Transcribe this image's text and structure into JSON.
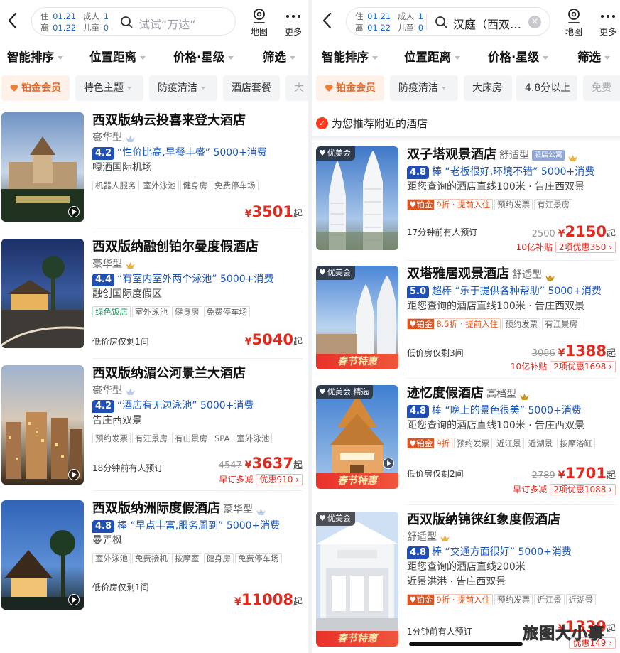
{
  "colors": {
    "accent_blue": "#1a55b8",
    "price_red": "#e02a1f",
    "platinum_orange": "#e46a2b"
  },
  "left": {
    "search": {
      "checkin_label": "住",
      "checkin_date": "01.21",
      "checkout_label": "离",
      "checkout_date": "01.22",
      "adult_label": "成人",
      "adult_count": "1",
      "child_label": "儿童",
      "child_count": "0",
      "placeholder": "试试“万达”"
    },
    "map_label": "地图",
    "more_label": "更多",
    "sort": [
      "智能排序",
      "位置距离",
      "价格·星级",
      "筛选"
    ],
    "chips": [
      "铂金会员",
      "特色主题",
      "防疫清洁",
      "酒店套餐",
      "大"
    ],
    "hotels": [
      {
        "name": "西双版纳云投喜来登大酒店",
        "level": "豪华型",
        "score": "4.2",
        "review": "“性价比高,早餐丰盛”",
        "consumers": "5000+消费",
        "location": "嘎洒国际机场",
        "tags": [
          "机器人服务",
          "室外泳池",
          "健身房",
          "免费停车场"
        ],
        "note": "",
        "price": "3501",
        "currency": "¥",
        "qi": "起",
        "old_price": "",
        "promo_left": "",
        "promo_right": ""
      },
      {
        "name": "西双版纳融创铂尔曼度假酒店",
        "level": "豪华型",
        "score": "4.4",
        "review": "“有室内室外两个泳池”",
        "consumers": "5000+消费",
        "location": "融创国际度假区",
        "tags": [
          "绿色饭店",
          "室外泳池",
          "健身房",
          "免费停车场"
        ],
        "note": "低价房仅剩1间",
        "price": "5040",
        "currency": "¥",
        "qi": "起",
        "old_price": "",
        "promo_left": "",
        "promo_right": ""
      },
      {
        "name": "西双版纳湄公河景兰大酒店",
        "level": "豪华型",
        "score": "4.2",
        "review": "“酒店有无边泳池”",
        "consumers": "5000+消费",
        "location": "告庄西双景",
        "tags": [
          "预约发票",
          "有江景房",
          "有山景房",
          "SPA",
          "室外泳池"
        ],
        "note": "18分钟前有人预订",
        "price": "3637",
        "currency": "¥",
        "qi": "起",
        "old_price": "4547",
        "promo_left": "早订多减",
        "promo_right": "优惠910 ›"
      },
      {
        "name": "西双版纳洲际度假酒店",
        "level": "豪华型",
        "score": "4.8",
        "score_word": "棒",
        "review": "“早点丰富,服务周到”",
        "consumers": "5000+消费",
        "location": "曼弄枫",
        "tags": [
          "室外泳池",
          "免费接机",
          "按摩室",
          "健身房",
          "免费停车场"
        ],
        "note": "低价房仅剩1间",
        "price": "11008",
        "currency": "¥",
        "qi": "起",
        "old_price": "",
        "promo_left": "",
        "promo_right": ""
      }
    ]
  },
  "right": {
    "search": {
      "checkin_label": "住",
      "checkin_date": "01.21",
      "checkout_label": "离",
      "checkout_date": "01.22",
      "adult_label": "成人",
      "adult_count": "1",
      "child_label": "儿童",
      "child_count": "0",
      "value": "汉庭（西双…",
      "clear": "×"
    },
    "map_label": "地图",
    "more_label": "更多",
    "sort": [
      "智能排序",
      "位置距离",
      "价格·星级",
      "筛选"
    ],
    "chips": [
      "铂金会员",
      "防疫清洁",
      "大床房",
      "4.8分以上",
      "免费"
    ],
    "recommend_title": "为您推荐附近的酒店",
    "recommend_icon": "thumb-up-icon",
    "hotels": [
      {
        "vtag": "优美会",
        "name": "双子塔观景酒店",
        "level": "舒适型",
        "apt": "酒店公寓",
        "score": "4.8",
        "score_word": "棒",
        "review": "“老板很好,环境不错”",
        "consumers": "5000+消费",
        "location": "距您查询的酒店直线100米 · 告庄西双景",
        "tags": [
          "铂金|9折 · 提前入住",
          "预约发票",
          "有江景房"
        ],
        "note": "17分钟前有人预订",
        "old_price": "2500",
        "currency": "¥",
        "price": "2150",
        "qi": "起",
        "promo_left": "10亿补贴",
        "promo_right": "2项优惠350 ›",
        "spring": ""
      },
      {
        "vtag": "优美会",
        "name": "双塔雅居观景酒店",
        "level": "舒适型",
        "apt": "",
        "score": "5.0",
        "score_word": "超棒",
        "review": "“乐于提供各种帮助”",
        "consumers": "5000+消费",
        "location": "距您查询的酒店直线100米 · 告庄西双景",
        "tags": [
          "铂金|8.5折 · 提前入住",
          "预约发票",
          "有江景房"
        ],
        "note": "低价房仅剩3间",
        "old_price": "3086",
        "currency": "¥",
        "price": "1388",
        "qi": "起",
        "promo_left": "10亿补贴",
        "promo_right": "2项优惠1698 ›",
        "spring": "春节特惠"
      },
      {
        "vtag": "优美会·精选",
        "name": "迹忆度假酒店",
        "level": "高档型",
        "apt": "",
        "score": "4.8",
        "score_word": "棒",
        "review": "“晚上的景色很美”",
        "consumers": "5000+消费",
        "location": "距您查询的酒店直线100米 · 告庄西双景",
        "tags": [
          "铂金|9折",
          "预约发票",
          "近江景",
          "近湖景",
          "按摩浴缸"
        ],
        "note": "低价房仅剩2间",
        "old_price": "2789",
        "currency": "¥",
        "price": "1701",
        "qi": "起",
        "promo_left": "早订多减",
        "promo_right": "2项优惠1088 ›",
        "spring": "春节特惠"
      },
      {
        "vtag": "优美会",
        "name": "西双版纳锦徕红象度假酒店",
        "level": "舒适型",
        "apt": "",
        "score": "4.8",
        "score_word": "棒",
        "review": "“交通方面很好”",
        "consumers": "5000+消费",
        "location": "距您查询的酒店直线200米",
        "location2": "近景洪港 · 告庄西双景",
        "tags": [
          "铂金|9折 · 提前入住",
          "预约发票",
          "近江景",
          "近湖景"
        ],
        "note": "1分钟前有人预订",
        "old_price": "",
        "currency": "¥",
        "price": "1339",
        "qi": "起",
        "promo_left": "",
        "promo_right": "优惠149 ›",
        "spring": "春节特惠"
      }
    ]
  },
  "watermark": "旅图大小事"
}
